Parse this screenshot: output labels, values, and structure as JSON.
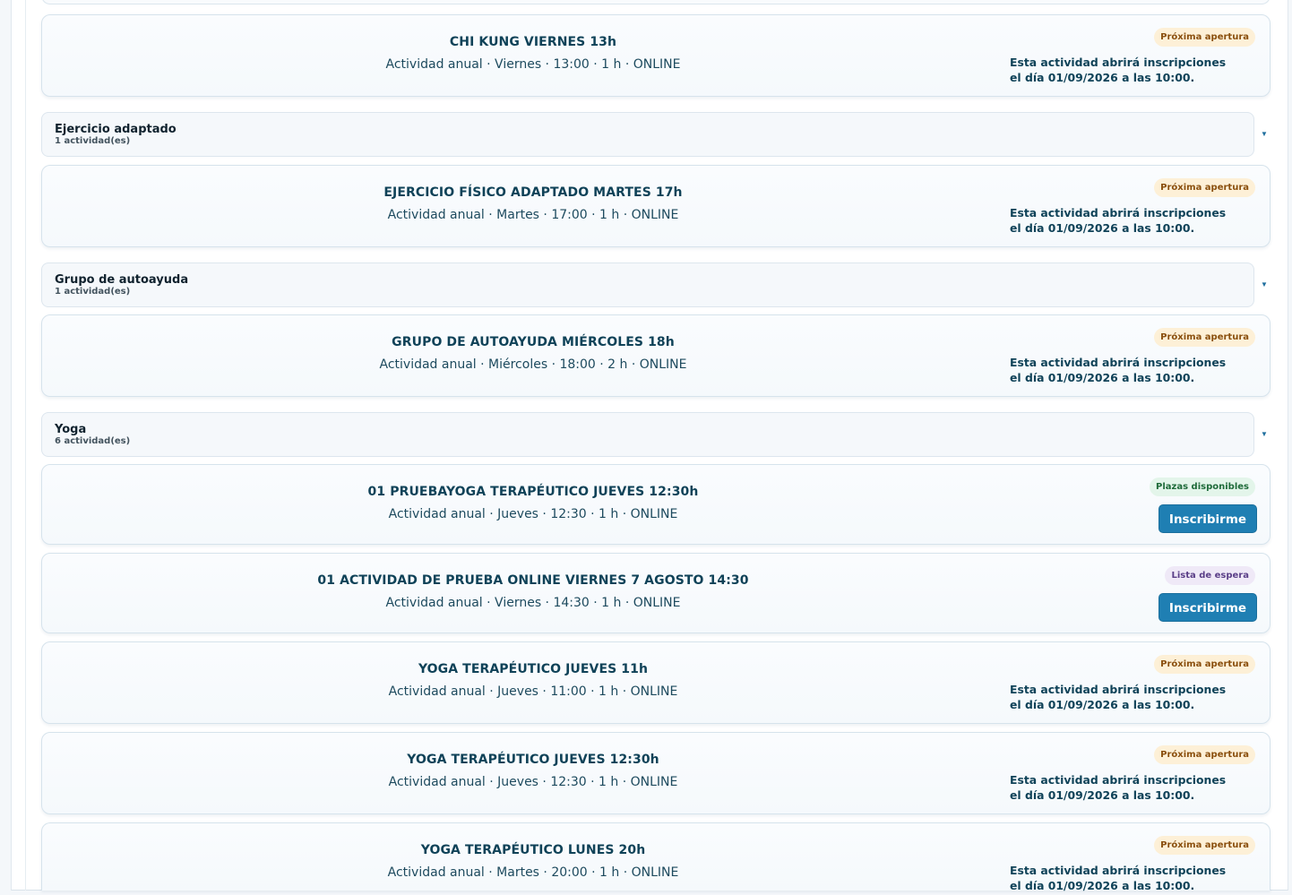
{
  "groups": [
    {
      "name": "Ejercicio adaptado",
      "count": "1 actividad(es)"
    },
    {
      "name": "Grupo de autoayuda",
      "count": "1 actividad(es)"
    },
    {
      "name": "Yoga",
      "count": "6 actividad(es)"
    }
  ],
  "chevron_glyph": "▼",
  "activities": [
    {
      "title": "CHI KUNG VIERNES 13h",
      "meta": "Actividad anual · Viernes · 13:00 · 1 h · ONLINE",
      "badge": "Próxima apertura",
      "note": "Esta actividad abrirá inscripciones el día 01/09/2026 a las 10:00."
    },
    {
      "title": "EJERCICIO FÍSICO ADAPTADO MARTES 17h",
      "meta": "Actividad anual · Martes · 17:00 · 1 h · ONLINE",
      "badge": "Próxima apertura",
      "note": "Esta actividad abrirá inscripciones el día 01/09/2026 a las 10:00."
    },
    {
      "title": "GRUPO DE AUTOAYUDA MIÉRCOLES 18h",
      "meta": "Actividad anual · Miércoles · 18:00 · 2 h · ONLINE",
      "badge": "Próxima apertura",
      "note": "Esta actividad abrirá inscripciones el día 01/09/2026 a las 10:00."
    },
    {
      "title": "01 PRUEBAYOGA TERAPÉUTICO JUEVES 12:30h",
      "meta": "Actividad anual · Jueves · 12:30 · 1 h · ONLINE",
      "badge": "Plazas disponibles",
      "button": "Inscribirme"
    },
    {
      "title": "01 ACTIVIDAD DE PRUEBA ONLINE VIERNES 7 AGOSTO 14:30",
      "meta": "Actividad anual · Viernes · 14:30 · 1 h · ONLINE",
      "badge": "Lista de espera",
      "button": "Inscribirme"
    },
    {
      "title": "YOGA TERAPÉUTICO JUEVES 11h",
      "meta": "Actividad anual · Jueves · 11:00 · 1 h · ONLINE",
      "badge": "Próxima apertura",
      "note": "Esta actividad abrirá inscripciones el día 01/09/2026 a las 10:00."
    },
    {
      "title": "YOGA TERAPÉUTICO JUEVES 12:30h",
      "meta": "Actividad anual · Jueves · 12:30 · 1 h · ONLINE",
      "badge": "Próxima apertura",
      "note": "Esta actividad abrirá inscripciones el día 01/09/2026 a las 10:00."
    },
    {
      "title": "YOGA TERAPÉUTICO LUNES 20h",
      "meta": "Actividad anual · Martes · 20:00 · 1 h · ONLINE",
      "badge": "Próxima apertura",
      "note": "Esta actividad abrirá inscripciones el día 01/09/2026 a las 10:00."
    }
  ],
  "colors": {
    "title": "#0f4258",
    "button": "#1f7fb3",
    "badge_open_bg": "#fdf0d7",
    "badge_available_bg": "#e3f5ea",
    "badge_waitlist_bg": "#efe9f7"
  }
}
